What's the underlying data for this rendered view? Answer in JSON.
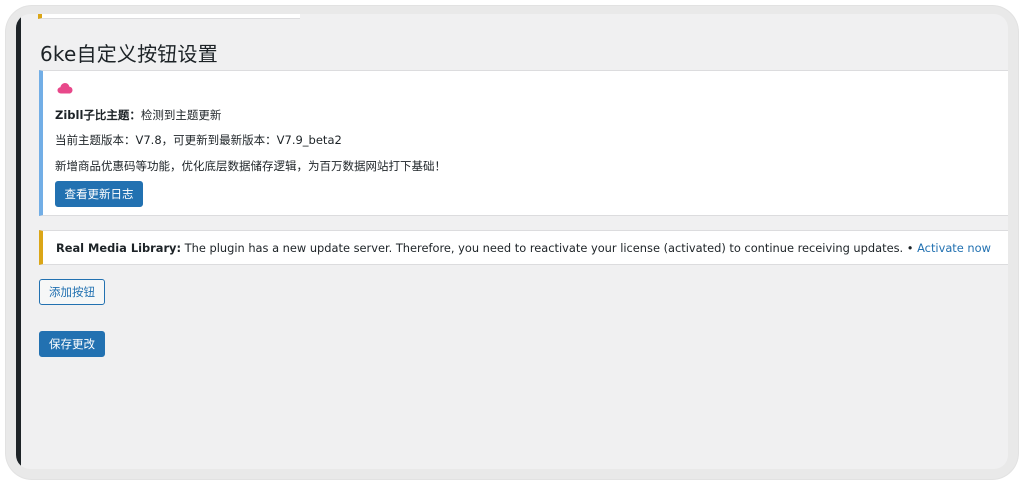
{
  "page": {
    "title": "6ke自定义按钮设置"
  },
  "update_notice": {
    "icon": "cloud-icon",
    "icon_color": "#e8488a",
    "theme_name": "Zibll子比主题：",
    "headline": "检测到主题更新",
    "version_text": "当前主题版本：V7.8，可更新到最新版本：V7.9_beta2",
    "description": "新增商品优惠码等功能，优化底层数据储存逻辑，为百万数据网站打下基础！",
    "changelog_button": "查看更新日志",
    "border_color": "#72aee6"
  },
  "rml_notice": {
    "plugin_name": "Real Media Library:",
    "message": " The plugin has a new update server. Therefore, you need to reactivate your license (activated) to continue receiving updates. • ",
    "link_label": "Activate now",
    "border_color": "#dba617"
  },
  "actions": {
    "add_button_label": "添加按钮",
    "save_button_label": "保存更改"
  },
  "colors": {
    "primary": "#2271b1",
    "background": "#f0f0f1",
    "admin_bar": "#1d2327"
  }
}
